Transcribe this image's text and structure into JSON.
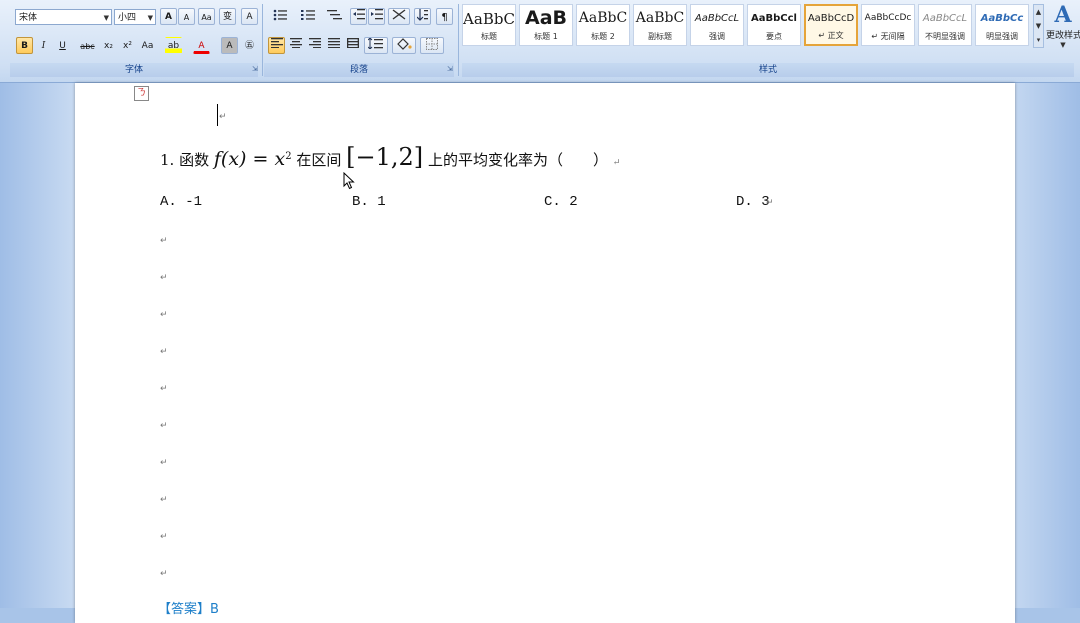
{
  "ribbon": {
    "font": {
      "name": "宋体",
      "size": "小四",
      "group_label": "字体",
      "buttons": [
        "A",
        "A",
        "Aa",
        "变",
        "A",
        "B",
        "I",
        "U",
        "abc",
        "x₂",
        "x²",
        "Aa",
        "ab",
        "A",
        "A",
        "㊄"
      ]
    },
    "paragraph": {
      "group_label": "段落"
    },
    "styles": {
      "group_label": "样式",
      "tiles": [
        {
          "sample": "AaBbC",
          "name": "标题"
        },
        {
          "sample": "AaB",
          "name": "标题 1"
        },
        {
          "sample": "AaBbC",
          "name": "标题 2"
        },
        {
          "sample": "AaBbC",
          "name": "副标题"
        },
        {
          "sample": "AaBbCcL",
          "name": "强调"
        },
        {
          "sample": "AaBbCcl",
          "name": "要点"
        },
        {
          "sample": "AaBbCcD",
          "name": "↵ 正文"
        },
        {
          "sample": "AaBbCcDc",
          "name": "↵ 无间隔"
        },
        {
          "sample": "AaBbCcL",
          "name": "不明显强调"
        },
        {
          "sample": "AaBbCc",
          "name": "明显强调"
        }
      ],
      "change_styles": "更改样式"
    }
  },
  "document": {
    "question": {
      "number": "1.",
      "text_a": "函数",
      "func": "f(x) = x",
      "exp": "2",
      "text_b": "在区间",
      "interval": "[−1,2]",
      "text_c": "上的平均变化率为（　　）"
    },
    "options": [
      "A.  -1",
      "B.  1",
      "C.  2",
      "D.  3"
    ],
    "answer": "【答案】B",
    "para_mark": "↵",
    "ime": "ㄋ"
  },
  "colors": {
    "accent": "#e5a43a",
    "ribbon_text": "#15428b",
    "answer": "#1e7fc9"
  }
}
